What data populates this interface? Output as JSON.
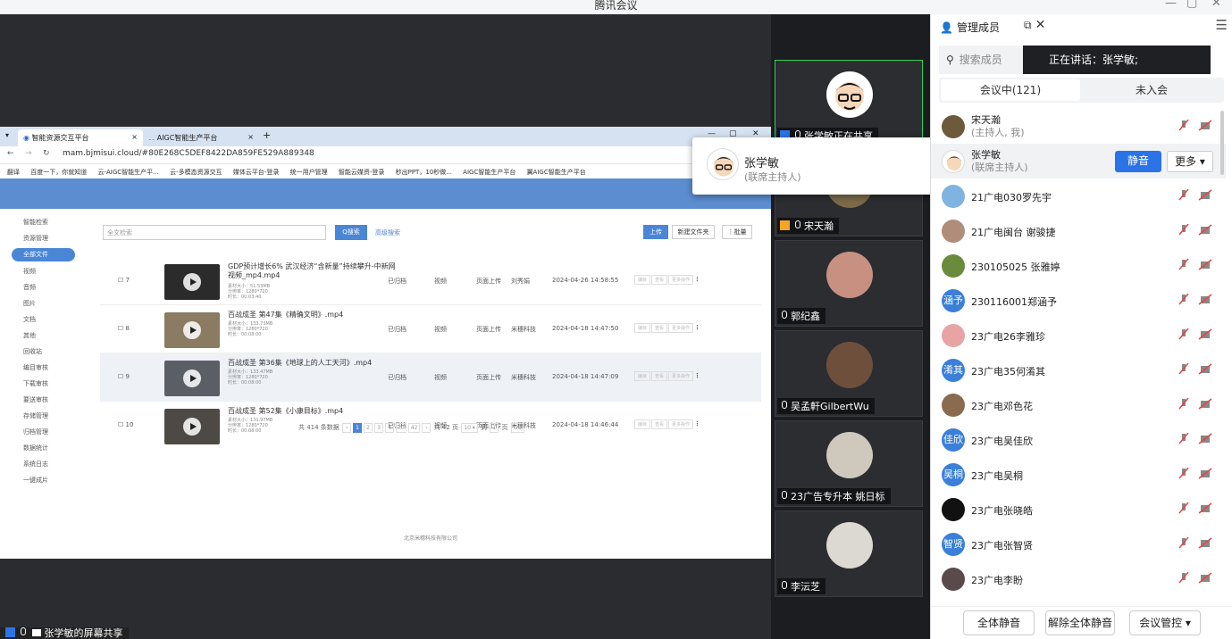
{
  "window": {
    "title": "腾讯会议",
    "controls": [
      "—",
      "▢",
      "✕"
    ]
  },
  "browser": {
    "tabs": [
      {
        "label": "智能资源交互平台",
        "close": "×"
      },
      {
        "label": "AIGC智能生产平台",
        "close": "×"
      }
    ],
    "new_tab": "+",
    "url": "mam.bjmisui.cloud/#80E268C5DEF8422DA859FE529A889348",
    "bookmarks": [
      "翻译",
      "百度一下，你就知道",
      "云-AIGC智能生产平...",
      "云-多模态资源交互",
      "媒体云平台-登录",
      "统一用户管理",
      "智能云媒资-登录",
      "秒出PPT，10秒做...",
      "AIGC智能生产平台",
      "翼AIGC智能生产平台"
    ]
  },
  "app": {
    "sidebar": [
      "智能检索",
      "资源管理",
      "全部文件",
      "视频",
      "音频",
      "图片",
      "文档",
      "其他",
      "回收站",
      "编目审核",
      "下载审核",
      "要送审核",
      "存储管理",
      "归档管理",
      "数据统计",
      "系统日志",
      "一键成片"
    ],
    "search_placeholder": "全文检索",
    "search_btn": "Q搜索",
    "adv_search": "高级搜索",
    "upload": "上传",
    "new_folder": "新建文件夹",
    "batch": "⋮批量",
    "rows": [
      {
        "idx": "7",
        "name": "GDP预计增长6% 武汉经济“含新量”持续攀升-中新网视频_mp4.mp4",
        "meta": [
          "素材大小：51.53MB",
          "分辨率：1280*720",
          "时长：00:03:40"
        ],
        "status": "已归档",
        "type": "视频",
        "source": "页面上传",
        "owner": "刘秀娟",
        "time": "2024-04-26 14:58:55"
      },
      {
        "idx": "8",
        "name": "百战成圣 第47集《精确文明》.mp4",
        "meta": [
          "素材大小：133.73MB",
          "分辨率：1280*720",
          "时长：00:08:00"
        ],
        "status": "已归档",
        "type": "视频",
        "source": "页面上传",
        "owner": "米穗科技",
        "time": "2024-04-18 14:47:50"
      },
      {
        "idx": "9",
        "name": "百战成圣 第36集《地球上的人工天河》.mp4",
        "meta": [
          "素材大小：133.47MB",
          "分辨率：1280*720",
          "时长：00:08:00"
        ],
        "status": "已归档",
        "type": "视频",
        "source": "页面上传",
        "owner": "米穗科技",
        "time": "2024-04-18 14:47:09"
      },
      {
        "idx": "10",
        "name": "百战成圣 第52集《小康目标》.mp4",
        "meta": [
          "素材大小：131.97MB",
          "分辨率：1280*720",
          "时长：00:08:00"
        ],
        "status": "已归档",
        "type": "视频",
        "source": "页面上传",
        "owner": "米穗科技",
        "time": "2024-04-18 14:46:44"
      }
    ],
    "row_ops": [
      "编目",
      "查看",
      "更多操作",
      "⋮"
    ],
    "pager": {
      "total": "共 414 条数据",
      "pages": [
        "‹",
        "1",
        "2",
        "3",
        "4",
        "...",
        "42",
        "›"
      ],
      "total_pages": "共 42 页",
      "size": "10 ▾",
      "goto": "到",
      "page_in": "1",
      "unit": "页",
      "go": "GO"
    },
    "footer": "北京米穗科技有限公司"
  },
  "share_label": "张学敏的屏幕共享",
  "tiles": [
    {
      "name": "张学敏正在共享",
      "speaking": true
    },
    {
      "name": "宋天瀚"
    },
    {
      "name": "郭纪鑫"
    },
    {
      "name": "吴孟軒GilbertWu"
    },
    {
      "name": "23广告专升本  姚日标"
    },
    {
      "name": "李沄芝"
    }
  ],
  "popup": {
    "name": "张学敏",
    "role": "(联席主持人)"
  },
  "panel": {
    "title": "管理成员",
    "search_placeholder": "搜索成员",
    "speaking": "正在讲话：张学敏;",
    "tab_in": "会议中(121)",
    "tab_out": "未入会",
    "members": [
      {
        "name": "宋天瀚",
        "sub": "(主持人, 我)",
        "badge": "",
        "color": "#6d5a3a"
      },
      {
        "name": "张学敏",
        "sub": "(联席主持人)",
        "badge": "",
        "color": "#ffffff"
      },
      {
        "name": "21广电030罗先宇",
        "badge": "",
        "color": "#7fb3e0"
      },
      {
        "name": "21广电闽台 谢骏捷",
        "badge": "",
        "color": "#b08c7a"
      },
      {
        "name": "230105025 张雅婷",
        "badge": "",
        "color": "#6a8a3c"
      },
      {
        "name": "230116001郑涵予",
        "badge": "涵予",
        "color": "#3b7fd9"
      },
      {
        "name": "23广电26李雅珍",
        "badge": "",
        "color": "#e8a4a4"
      },
      {
        "name": "23广电35何淆其",
        "badge": "淆其",
        "color": "#3b7fd9"
      },
      {
        "name": "23广电邓色花",
        "badge": "",
        "color": "#8a6b4f"
      },
      {
        "name": "23广电吴佳欣",
        "badge": "佳欣",
        "color": "#3b7fd9"
      },
      {
        "name": "23广电吴桐",
        "badge": "吴桐",
        "color": "#3b7fd9"
      },
      {
        "name": "23广电张晓皓",
        "badge": "",
        "color": "#111111"
      },
      {
        "name": "23广电张智贤",
        "badge": "智贤",
        "color": "#3b7fd9"
      },
      {
        "name": "23广电李盼",
        "badge": "",
        "color": "#5b4a4a"
      }
    ],
    "mute": "静音",
    "more": "更多 ▾",
    "mute_all": "全体静音",
    "unmute_all": "解除全体静音",
    "control": "会议管控 ▾"
  }
}
